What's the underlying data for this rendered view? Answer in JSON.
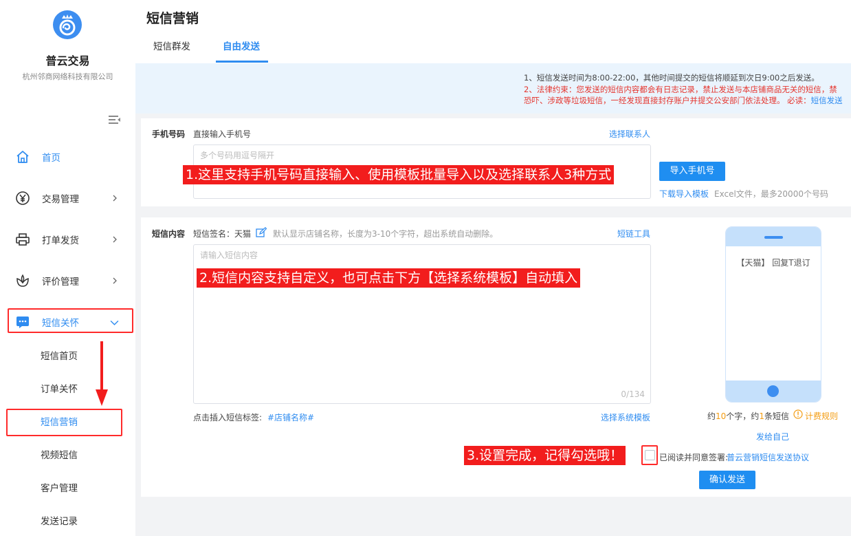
{
  "sidebar": {
    "brand_name": "普云交易",
    "company": "杭州邻商网络科技有限公司",
    "items": [
      {
        "label": "首页"
      },
      {
        "label": "交易管理"
      },
      {
        "label": "打单发货"
      },
      {
        "label": "评价管理"
      },
      {
        "label": "短信关怀"
      }
    ],
    "sub_items": [
      {
        "label": "短信首页"
      },
      {
        "label": "订单关怀"
      },
      {
        "label": "短信营销"
      },
      {
        "label": "视频短信"
      },
      {
        "label": "客户管理"
      },
      {
        "label": "发送记录"
      }
    ]
  },
  "header": {
    "title": "短信营销",
    "tabs": [
      {
        "label": "短信群发"
      },
      {
        "label": "自由发送"
      }
    ]
  },
  "notice": {
    "line1": "1、短信发送时间为8:00-22:00，其他时间提交的短信将顺延到次日9:00之后发送。",
    "line2": "2、法律约束：您发送的短信内容都会有日志记录，禁止发送与本店铺商品无关的短信，禁",
    "line3": "恐吓、涉政等垃圾短信，一经发现直接封存账户并提交公安部门依法处理。 必读：",
    "line3_link": "短信发送"
  },
  "phone_section": {
    "label": "手机号码",
    "hint": "直接输入手机号",
    "select_contacts": "选择联系人",
    "placeholder": "多个号码用逗号隔开",
    "import_button": "导入手机号",
    "download_template": "下载导入模板",
    "import_note": "Excel文件，最多20000个号码"
  },
  "content_section": {
    "label": "短信内容",
    "signature_label": "短信签名：天猫",
    "signature_note": "默认显示店铺名称，长度为3-10个字符，超出系统自动删除。",
    "link_tool": "短链工具",
    "placeholder": "请输入短信内容",
    "counter": "0/134",
    "insert_tag_label": "点击插入短信标签:",
    "insert_tag": "#店铺名称#",
    "select_template": "选择系统模板"
  },
  "preview": {
    "text": "【天猫】 回复T退订",
    "stat_prefix": "约",
    "char_count": "10",
    "stat_mid": "个字，约",
    "sms_count": "1",
    "stat_suffix": "条短信",
    "billing_rules": "计费规则",
    "send_self": "发给自己"
  },
  "agreement": {
    "text": "已阅读并同意签署:",
    "link": "普云营销短信发送协议",
    "checked": false
  },
  "confirm_button": "确认发送",
  "callouts": {
    "c1": "1.这里支持手机号码直接输入、使用模板批量导入以及选择联系人3种方式",
    "c2": "2.短信内容支持自定义，也可点击下方【选择系统模板】自动填入",
    "c3": "3.设置完成，记得勾选哦！"
  },
  "colors": {
    "accent": "#2f8cf0",
    "callout_red": "#f21d1d",
    "notice_bg": "#eaf4fd"
  }
}
